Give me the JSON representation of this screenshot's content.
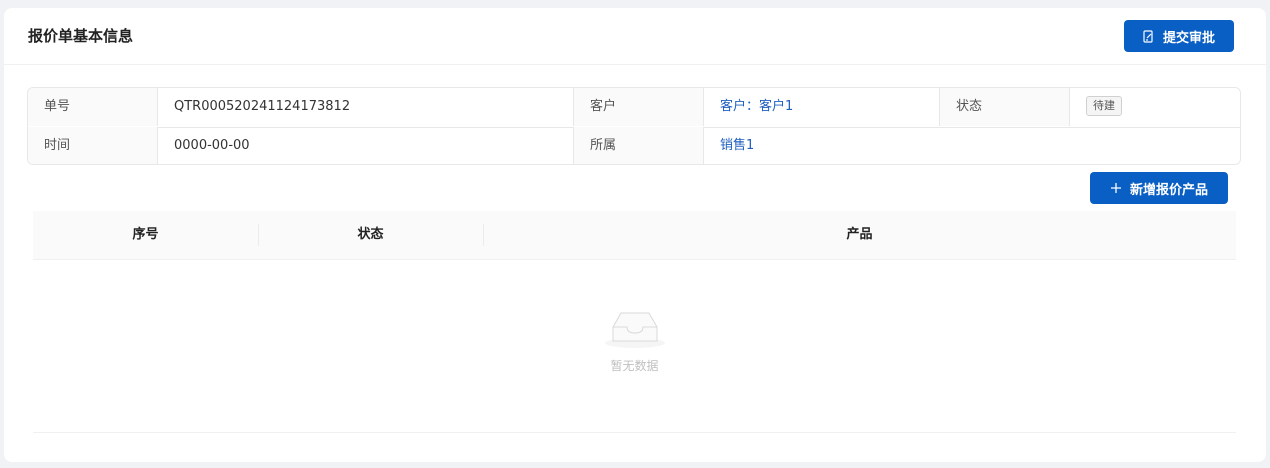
{
  "header": {
    "title": "报价单基本信息",
    "submit_label": "提交审批"
  },
  "info": {
    "order_no_label": "单号",
    "order_no_value": "QTR000520241124173812",
    "customer_label": "客户",
    "customer_value": "客户：客户1",
    "status_label": "状态",
    "status_value": "待建",
    "time_label": "时间",
    "time_value": "0000-00-00",
    "owner_label": "所属",
    "owner_value": "销售1"
  },
  "products": {
    "add_label": "新增报价产品",
    "columns": [
      "序号",
      "状态",
      "产品"
    ],
    "empty_text": "暂无数据"
  },
  "colors": {
    "primary": "#0a5fc4",
    "link": "#1f5fbf"
  }
}
